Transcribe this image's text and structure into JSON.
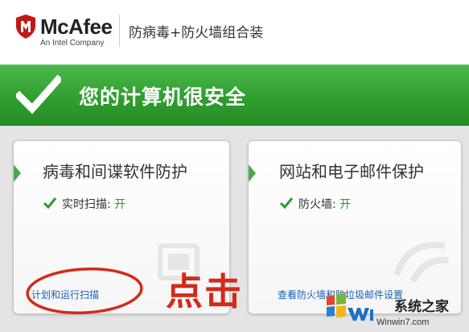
{
  "header": {
    "brand": "McAfee",
    "brand_sub": "An Intel Company",
    "product": "防病毒+防火墙组合装"
  },
  "banner": {
    "status": "您的计算机很安全"
  },
  "cards": [
    {
      "title": "病毒和间谍软件防护",
      "status_label": "实时扫描: ",
      "status_value": "开",
      "link": "计划和运行扫描"
    },
    {
      "title": "网站和电子邮件保护",
      "status_label": "防火墙: ",
      "status_value": "开",
      "link": "查看防火墙和防垃圾邮件设置"
    }
  ],
  "annotation": {
    "text": "点击"
  },
  "watermark": {
    "name": "系统之家",
    "url": "Winwin7.com",
    "logo_letters": "Win7"
  },
  "colors": {
    "brand_red": "#c01818",
    "banner_green": "#2f9e2f",
    "status_green": "#2e9a2e",
    "link_blue": "#1a5fb4",
    "annotation_red": "#d42a1a"
  }
}
